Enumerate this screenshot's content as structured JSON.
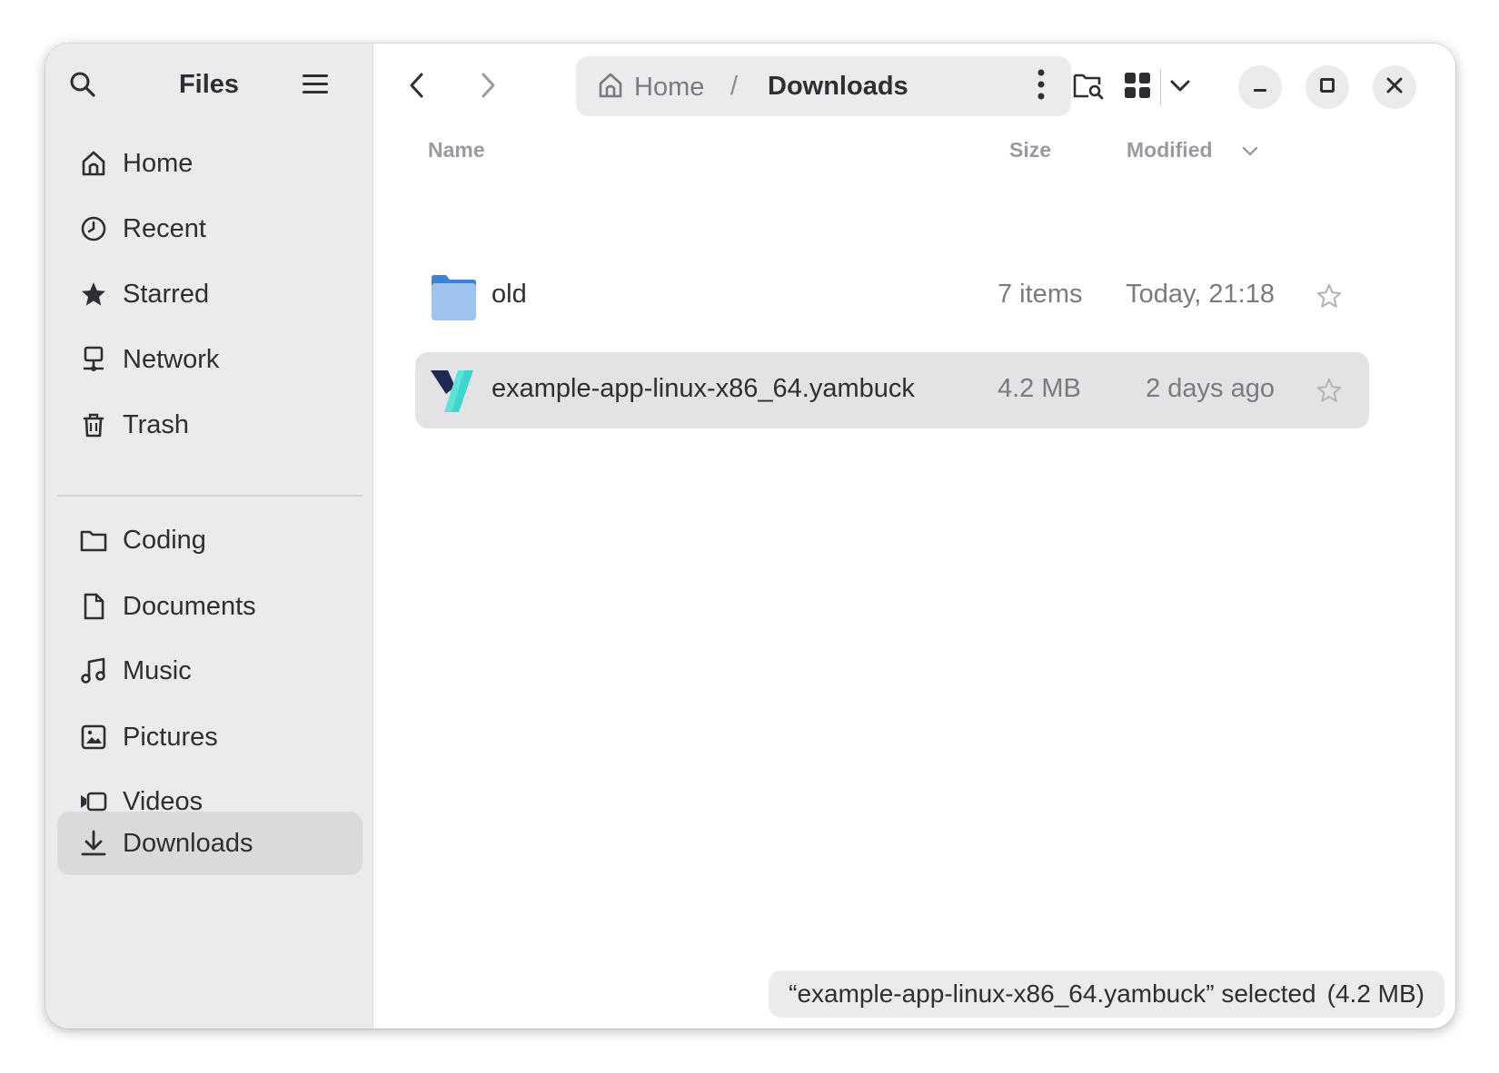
{
  "sidebar": {
    "title": "Files",
    "places": [
      {
        "label": "Home",
        "icon": "home-icon"
      },
      {
        "label": "Recent",
        "icon": "clock-icon"
      },
      {
        "label": "Starred",
        "icon": "star-icon"
      },
      {
        "label": "Network",
        "icon": "network-icon"
      },
      {
        "label": "Trash",
        "icon": "trash-icon"
      }
    ],
    "bookmarks": [
      {
        "label": "Coding",
        "icon": "folder-icon"
      },
      {
        "label": "Documents",
        "icon": "document-icon"
      },
      {
        "label": "Music",
        "icon": "music-icon"
      },
      {
        "label": "Pictures",
        "icon": "picture-icon"
      },
      {
        "label": "Videos",
        "icon": "video-icon"
      },
      {
        "label": "Downloads",
        "icon": "download-icon",
        "active": true
      }
    ]
  },
  "pathbar": {
    "home": "Home",
    "separator": "/",
    "current": "Downloads"
  },
  "columns": {
    "name": "Name",
    "size": "Size",
    "modified": "Modified"
  },
  "files": [
    {
      "name": "old",
      "size": "7 items",
      "modified": "Today, 21:18",
      "icon": "folder-icon",
      "selected": false
    },
    {
      "name": "example-app-linux-x86_64.yambuck",
      "size": "4.2 MB",
      "modified": "2 days ago",
      "icon": "yambuck-app-icon",
      "selected": true
    }
  ],
  "status": {
    "selection": "“example-app-linux-x86_64.yambuck” selected",
    "size": "(4.2 MB)"
  },
  "colors": {
    "sidebar_bg": "#ebebed",
    "selected_row": "#e3e3e5",
    "folder_blue": "#9dc3ee",
    "text": "#2e2e33",
    "dim_text": "#7a7a80"
  }
}
